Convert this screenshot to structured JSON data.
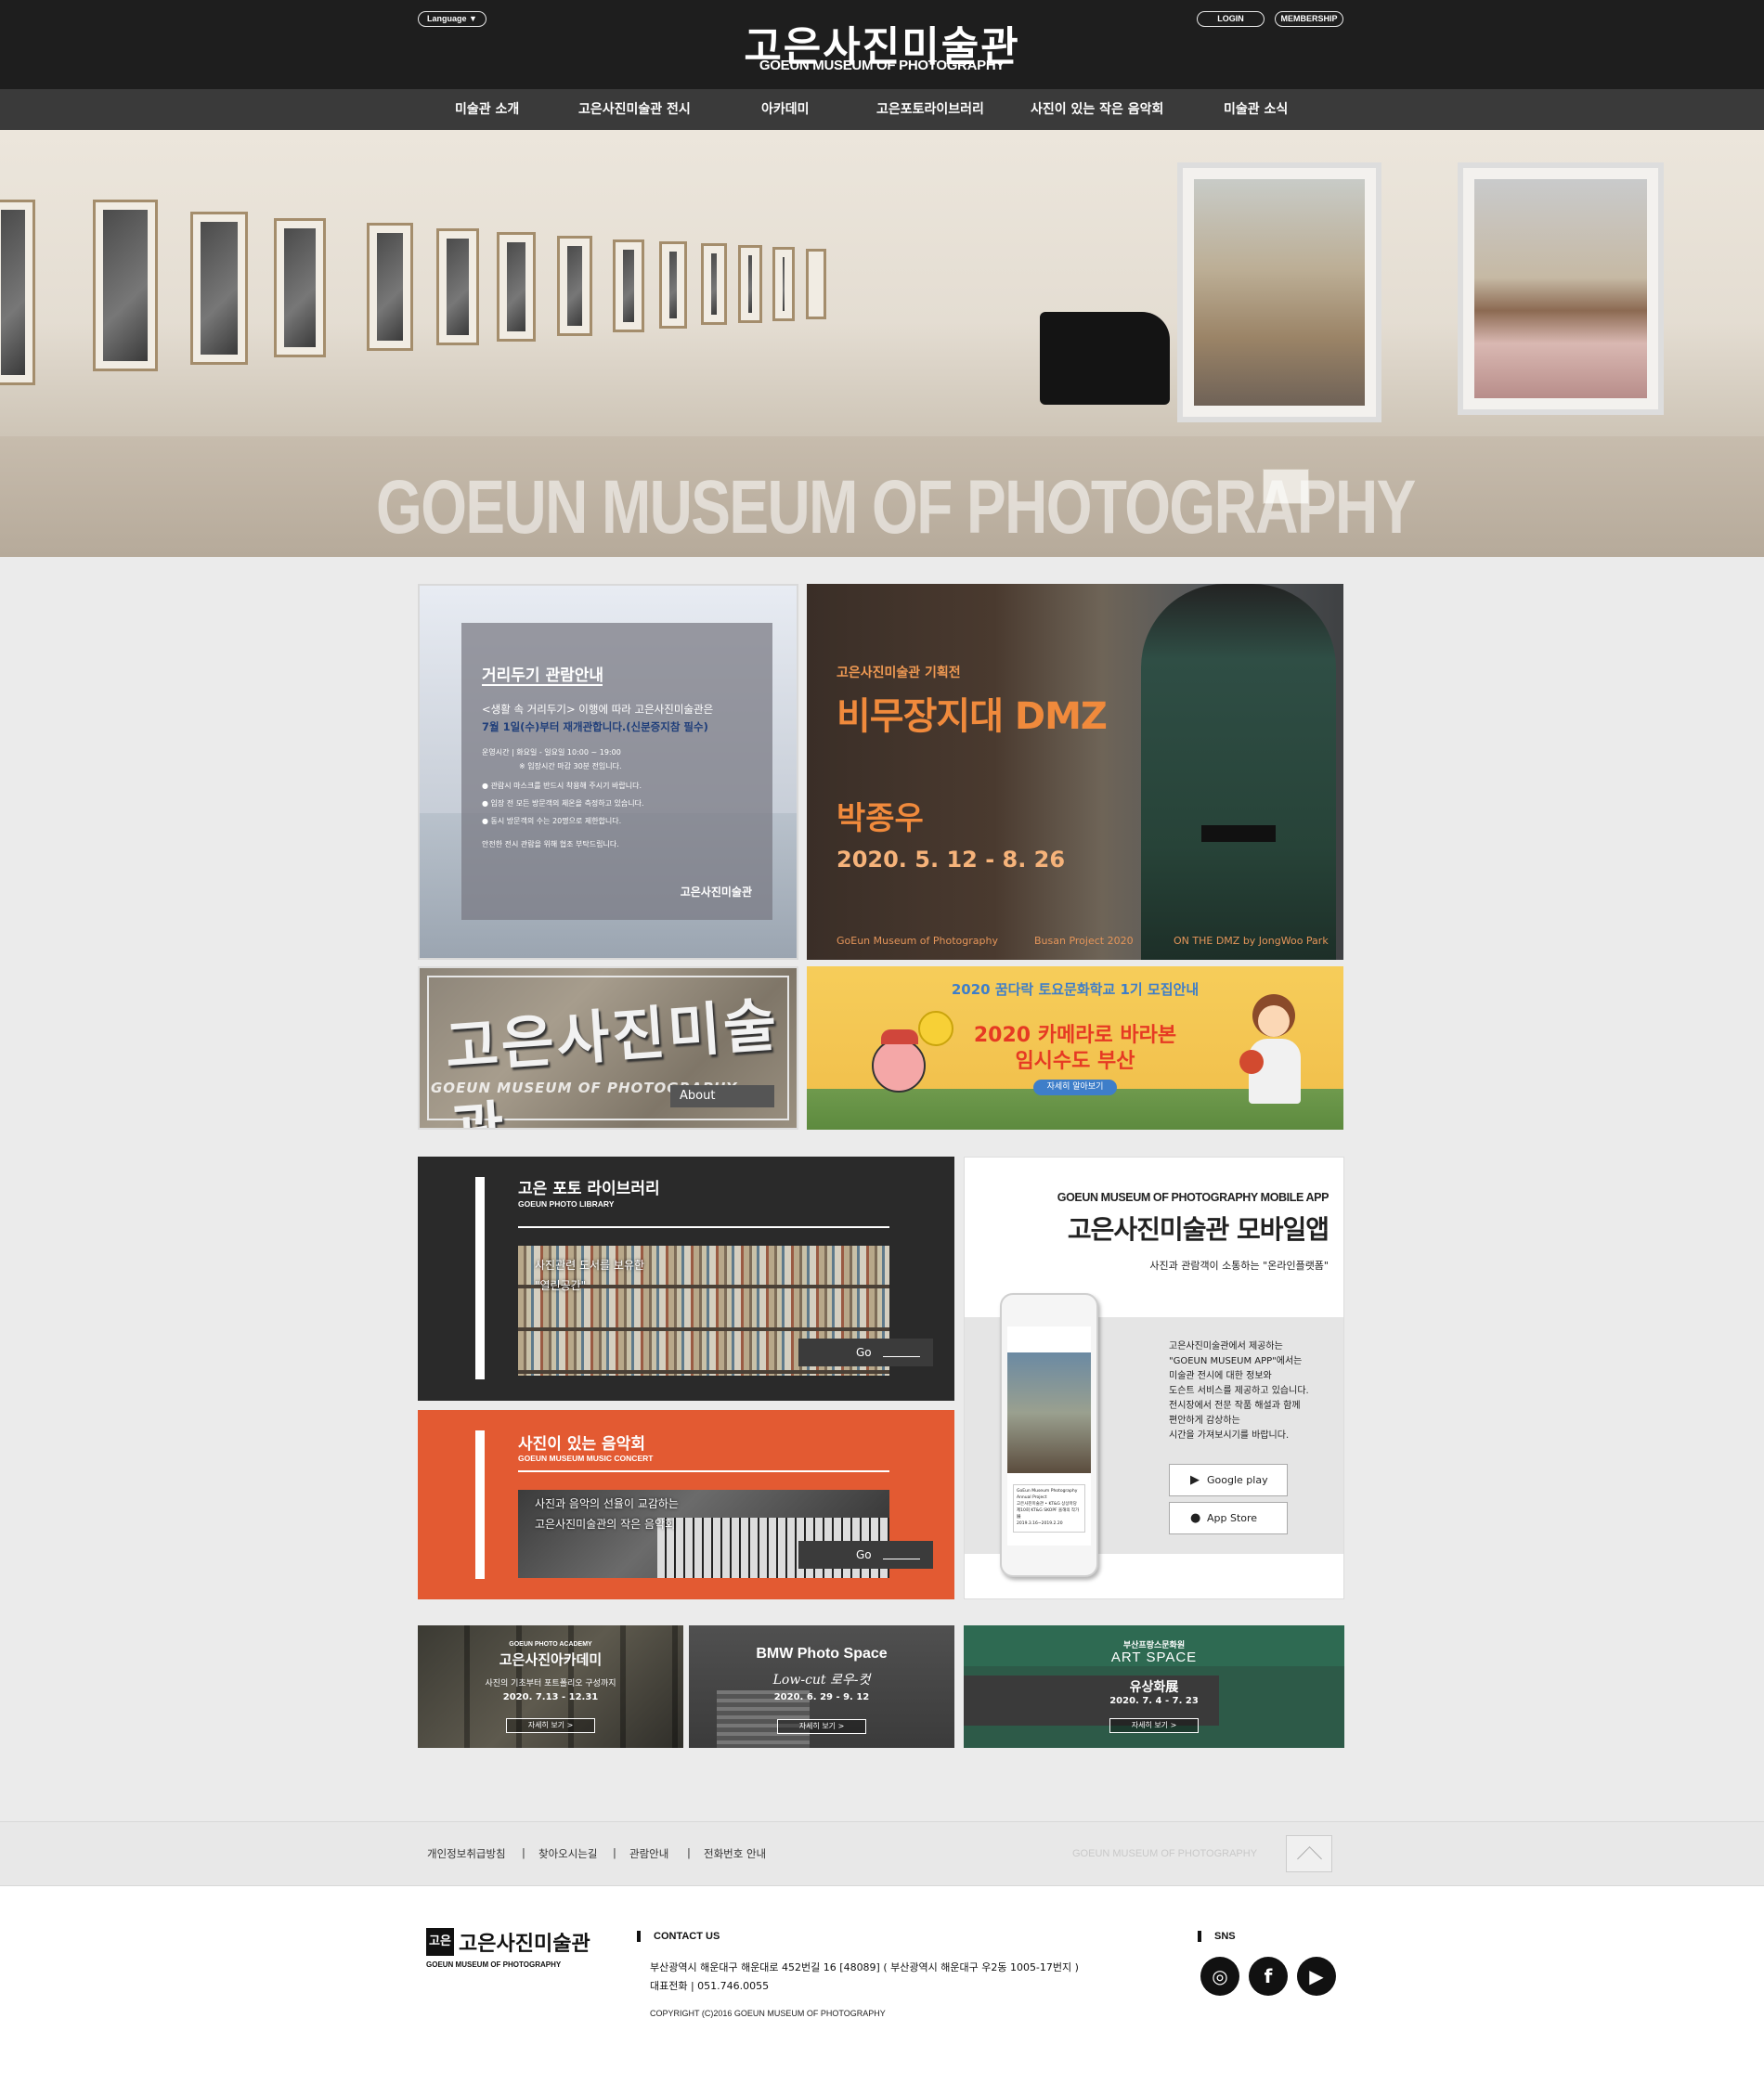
{
  "header": {
    "language_label": "Language ▼",
    "login_label": "LOGIN",
    "membership_label": "MEMBERSHIP",
    "logo_ko": "고은사진미술관",
    "logo_en": "GOEUN MUSEUM OF PHOTOGRAPHY"
  },
  "nav": {
    "items": [
      {
        "label": "미술관 소개"
      },
      {
        "label": "고은사진미술관 전시"
      },
      {
        "label": "아카데미"
      },
      {
        "label": "고은포토라이브러리"
      },
      {
        "label": "사진이 있는 작은 음악회"
      },
      {
        "label": "미술관 소식"
      }
    ]
  },
  "hero": {
    "overlay_text": "GOEUN MUSEUM OF PHOTOGRAPHY"
  },
  "notice_banner": {
    "title": "거리두기 관람안내",
    "line1": "<생활 속 거리두기> 이행에 따라 고은사진미술관은",
    "line2": "7월 1일(수)부터 재개관합니다.(신분증지참 필수)",
    "hours1": "운영시간 | 화요일 - 일요일  10:00 ~ 19:00",
    "hours2": "※ 입장시간 마감 30분 전입니다.",
    "rules": [
      "관람시 마스크를 반드시 착용해 주시기 바랍니다.",
      "입장 전 모든 방문객의 체온을 측정하고 있습니다.",
      "동시 방문객의 수는 20명으로 제한합니다."
    ],
    "closing": "안전한 전시 관람을 위해 협조 부탁드립니다.",
    "logo": "고은사진미술관"
  },
  "dmz_banner": {
    "subtitle": "고은사진미술관 기획전",
    "title": "비무장지대 DMZ",
    "artist": "박종우",
    "dates": "2020. 5. 12 - 8. 26",
    "footer_left": "GoEun Museum of Photography",
    "footer_mid": "Busan Project 2020",
    "footer_right": "ON THE DMZ by JongWoo Park"
  },
  "about_banner": {
    "sign_ko": "고은사진미술관",
    "sign_en": "GOEUN MUSEUM OF PHOTOGRAPHY",
    "button": "About"
  },
  "school_banner": {
    "top": "2020 꿈다락 토요문화학교 1기 모집안내",
    "line1": "2020 카메라로 바라본",
    "line2": "임시수도 부산",
    "button": "자세히 알아보기"
  },
  "library": {
    "title_ko": "고은 포토 라이브러리",
    "title_en": "GOEUN PHOTO LIBRARY",
    "img_line1": "사진관련 도서를 보유한",
    "img_line2": "\"열린공간\"",
    "go": "Go"
  },
  "concert": {
    "title_ko": "사진이 있는 음악회",
    "title_en": "GOEUN MUSEUM MUSIC CONCERT",
    "img_line1": "사진과 음악의 선율이 교감하는",
    "img_line2": "고은사진미술관의 작은 음악회",
    "go": "Go"
  },
  "app": {
    "title_en": "GOEUN MUSEUM OF PHOTOGRAPHY MOBILE APP",
    "title_ko": "고은사진미술관 모바일앱",
    "subtitle": "사진과 관람객이 소통하는 \"온라인플랫폼\"",
    "desc": [
      "고은사진미술관에서 제공하는",
      "\"GOEUN MUSEUM APP\"에서는",
      "미술관 전시에 대한 정보와",
      "도슨트 서비스를 제공하고 있습니다.",
      "전시장에서 전문 작품 해설과 함께",
      "편안하게 감상하는",
      "시간을 가져보시기를 바랍니다."
    ],
    "google_play": "Google play",
    "app_store": "App Store",
    "phone_card": [
      "GoEun Museum Photography Annual Project",
      "고은사진미술관 • KT&G 상상마당",
      "제10회 KT&G SKOPF 올해의 작가展",
      "2019.3.16~2019.2.20"
    ]
  },
  "small_banners": {
    "academy": {
      "en": "GOEUN PHOTO ACADEMY",
      "title": "고은사진아카데미",
      "desc": "사진의 기초부터 포트폴리오 구성까지",
      "dates": "2020. 7.13 - 12.31",
      "button": "자세히 보기 >"
    },
    "bmw": {
      "title": "BMW Photo Space",
      "subtitle": "Low-cut 로우-컷",
      "dates": "2020. 6. 29 - 9. 12",
      "button": "자세히 보기 >"
    },
    "art": {
      "top": "부산프랑스문화원",
      "title": "ART SPACE",
      "name": "유상화展",
      "dates": "2020. 7. 4 - 7. 23",
      "button": "자세히 보기 >"
    }
  },
  "footer_links": {
    "items": [
      "개인정보취급방침",
      "찾아오시는길",
      "관람안내",
      "전화번호 안내"
    ],
    "separator": "|",
    "brand": "GOEUN MUSEUM OF PHOTOGRAPHY"
  },
  "footer": {
    "logo_box": "고은",
    "logo_ko": "고은사진미술관",
    "logo_en": "GOEUN MUSEUM OF PHOTOGRAPHY",
    "contact_title": "CONTACT US",
    "address": "부산광역시 해운대구 해운대로 452번길 16 [48089] ( 부산광역시 해운대구 우2동 1005-17번지 )",
    "phone": "대표전화 | 051.746.0055",
    "copyright": "COPYRIGHT (C)2016 GOEUN MUSEUM OF PHOTOGRAPHY",
    "sns_title": "SNS",
    "sns_icons": [
      "instagram-icon",
      "facebook-icon",
      "youtube-icon"
    ]
  },
  "colors": {
    "header_bg": "#1e1e1e",
    "nav_bg": "#3a3a3a",
    "concert_orange": "#e35a32",
    "dmz_orange": "#f08a3c",
    "art_space_green": "#2e6a52"
  }
}
